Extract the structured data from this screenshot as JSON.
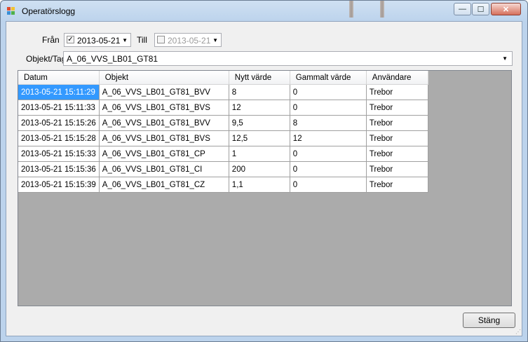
{
  "window": {
    "title": "Operatörslogg",
    "controls": {
      "minimize": "—",
      "maximize": "☐",
      "close": "✕"
    }
  },
  "filter": {
    "from_label": "Från",
    "from_checked": true,
    "from_date": "2013-05-21",
    "to_label": "Till",
    "to_checked": false,
    "to_date": "2013-05-21",
    "object_label": "Objekt/Tag",
    "object_value": "A_06_VVS_LB01_GT81"
  },
  "grid": {
    "columns": [
      "Datum",
      "Objekt",
      "Nytt värde",
      "Gammalt värde",
      "Användare"
    ],
    "rows": [
      [
        "2013-05-21 15:11:29",
        "A_06_VVS_LB01_GT81_BVV",
        "8",
        "0",
        "Trebor"
      ],
      [
        "2013-05-21 15:11:33",
        "A_06_VVS_LB01_GT81_BVS",
        "12",
        "0",
        "Trebor"
      ],
      [
        "2013-05-21 15:15:26",
        "A_06_VVS_LB01_GT81_BVV",
        "9,5",
        "8",
        "Trebor"
      ],
      [
        "2013-05-21 15:15:28",
        "A_06_VVS_LB01_GT81_BVS",
        "12,5",
        "12",
        "Trebor"
      ],
      [
        "2013-05-21 15:15:33",
        "A_06_VVS_LB01_GT81_CP",
        "1",
        "0",
        "Trebor"
      ],
      [
        "2013-05-21 15:15:36",
        "A_06_VVS_LB01_GT81_CI",
        "200",
        "0",
        "Trebor"
      ],
      [
        "2013-05-21 15:15:39",
        "A_06_VVS_LB01_GT81_CZ",
        "1,1",
        "0",
        "Trebor"
      ]
    ]
  },
  "buttons": {
    "close_label": "Stäng"
  }
}
